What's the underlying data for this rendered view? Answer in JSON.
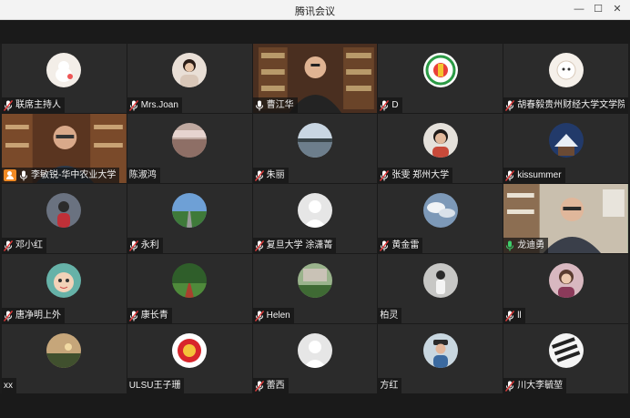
{
  "window": {
    "title": "腾讯会议",
    "minimize_glyph": "—",
    "maximize_glyph": "☐",
    "close_glyph": "✕"
  },
  "colors": {
    "tile_bg": "#2b2b2b",
    "active_speaker_border": "#3a8f5a",
    "host_badge": "#f08a24"
  },
  "participants": [
    {
      "name": "联席主持人",
      "mic": "muted",
      "avatar": "white-cat"
    },
    {
      "name": "Mrs.Joan",
      "mic": "muted",
      "avatar": "portrait-woman"
    },
    {
      "name": "曹江华",
      "mic": "on",
      "avatar": "video-man-bookshelf",
      "video": true
    },
    {
      "name": "D",
      "mic": "muted",
      "avatar": "green-logo"
    },
    {
      "name": "胡春毅贵州财经大学文学院",
      "mic": "muted",
      "avatar": "cartoon-white"
    },
    {
      "name": "李敏锐-华中农业大学",
      "mic": "on",
      "host": true,
      "avatar": "video-man-glasses",
      "video": true
    },
    {
      "name": "陈淑鸿",
      "mic": "none",
      "avatar": "crowd-photo"
    },
    {
      "name": "朱丽",
      "mic": "muted",
      "avatar": "lake-photo"
    },
    {
      "name": "张雯 郑州大学",
      "mic": "muted",
      "avatar": "woman-photo"
    },
    {
      "name": "kissummer",
      "mic": "muted",
      "avatar": "winter-house"
    },
    {
      "name": "邓小红",
      "mic": "muted",
      "avatar": "person-dark"
    },
    {
      "name": "永利",
      "mic": "muted",
      "avatar": "road-landscape"
    },
    {
      "name": "复旦大学 涂潇菁",
      "mic": "muted",
      "avatar": "default-user"
    },
    {
      "name": "黄金雷",
      "mic": "muted",
      "avatar": "clouds-photo"
    },
    {
      "name": "龙迪勇",
      "mic": "speaking",
      "avatar": "video-man-office",
      "video": true,
      "highlight": true
    },
    {
      "name": "唐净明上外",
      "mic": "muted",
      "avatar": "cartoon-animal"
    },
    {
      "name": "康长青",
      "mic": "muted",
      "avatar": "park-path"
    },
    {
      "name": "Helen",
      "mic": "muted",
      "avatar": "garden-plants"
    },
    {
      "name": "柏灵",
      "mic": "none",
      "avatar": "person-grey"
    },
    {
      "name": "ll",
      "mic": "muted",
      "avatar": "portrait-pink"
    },
    {
      "name": "xx",
      "mic": "none",
      "avatar": "sunset-field"
    },
    {
      "name": "ULSU王子珊",
      "mic": "none",
      "avatar": "red-logo"
    },
    {
      "name": "蕾西",
      "mic": "muted",
      "avatar": "default-user"
    },
    {
      "name": "方红",
      "mic": "none",
      "avatar": "man-hat"
    },
    {
      "name": "川大李毓堃",
      "mic": "muted",
      "avatar": "bw-abstract"
    }
  ]
}
